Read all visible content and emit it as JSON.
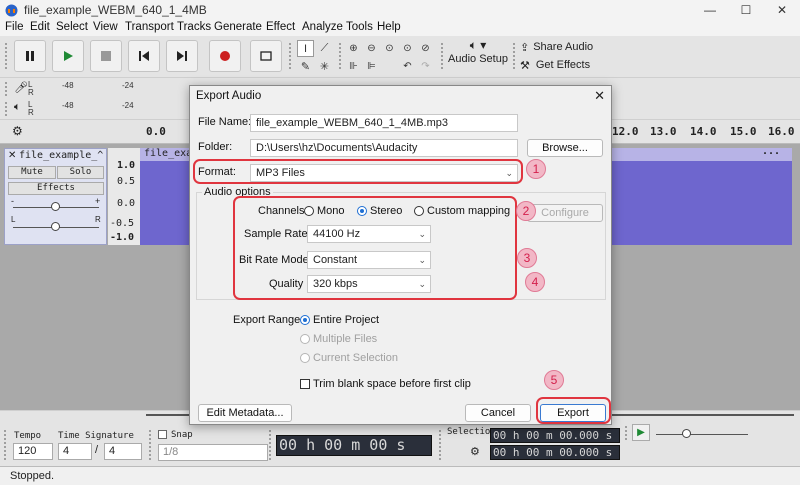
{
  "window": {
    "title": "file_example_WEBM_640_1_4MB",
    "minimize": "—",
    "maximize": "☐",
    "close": "✕"
  },
  "menu": [
    "File",
    "Edit",
    "Select",
    "View",
    "Transport",
    "Tracks",
    "Generate",
    "Effect",
    "Analyze",
    "Tools",
    "Help"
  ],
  "toolbar": {
    "audio_setup": "Audio Setup",
    "share_audio": "Share Audio",
    "get_effects": "Get Effects"
  },
  "meters": {
    "ticks": [
      "-48",
      "-24",
      "-48",
      "-24"
    ],
    "lr": [
      "L",
      "R",
      "L",
      "R"
    ]
  },
  "ruler": {
    "start": "0.0",
    "labels": [
      "12.0",
      "13.0",
      "14.0",
      "15.0",
      "16.0"
    ]
  },
  "track": {
    "name": "file_example_^",
    "mute": "Mute",
    "solo": "Solo",
    "effects": "Effects",
    "pan_minus": "-",
    "pan_plus": "+",
    "left": "L",
    "right": "R",
    "scale": [
      "1.0",
      "0.5",
      "0.0",
      "-0.5",
      "-1.0"
    ],
    "clip_name": "file_exa",
    "clip_menu": "..."
  },
  "bottom": {
    "tempo_label": "Tempo",
    "tempo_value": "120",
    "time_sig_label": "Time Signature",
    "time_sig_num": "4",
    "time_sig_sep": "/",
    "time_sig_den": "4",
    "snap_label": "Snap",
    "snap_value": "1/8",
    "time_display": "00 h 00 m 00 s",
    "selection_label": "Selection",
    "selection_start": "00 h 00 m 00.000 s",
    "selection_end": "00 h 00 m 00.000 s"
  },
  "status": "Stopped.",
  "dialog": {
    "title": "Export Audio",
    "file_name_label": "File Name:",
    "file_name": "file_example_WEBM_640_1_4MB.mp3",
    "folder_label": "Folder:",
    "folder": "D:\\Users\\hz\\Documents\\Audacity",
    "browse": "Browse...",
    "format_label": "Format:",
    "format": "MP3 Files",
    "audio_options": "Audio options",
    "channels_label": "Channels",
    "channel_options": [
      "Mono",
      "Stereo",
      "Custom mapping"
    ],
    "configure": "Configure",
    "sample_rate_label": "Sample Rate",
    "sample_rate": "44100 Hz",
    "bit_rate_mode_label": "Bit Rate Mode",
    "bit_rate_mode": "Constant",
    "quality_label": "Quality",
    "quality": "320 kbps",
    "export_range_label": "Export Range:",
    "range_options": [
      "Entire Project",
      "Multiple Files",
      "Current Selection"
    ],
    "trim_label": "Trim blank space before first clip",
    "edit_metadata": "Edit Metadata...",
    "cancel": "Cancel",
    "export": "Export"
  },
  "annotations": [
    "1",
    "2",
    "3",
    "4",
    "5"
  ],
  "colors": {
    "waveform": "#6e66ce",
    "annotation_red": "#e0353f",
    "badge_fill": "#f2b7c6",
    "badge_text": "#d31f4b"
  }
}
